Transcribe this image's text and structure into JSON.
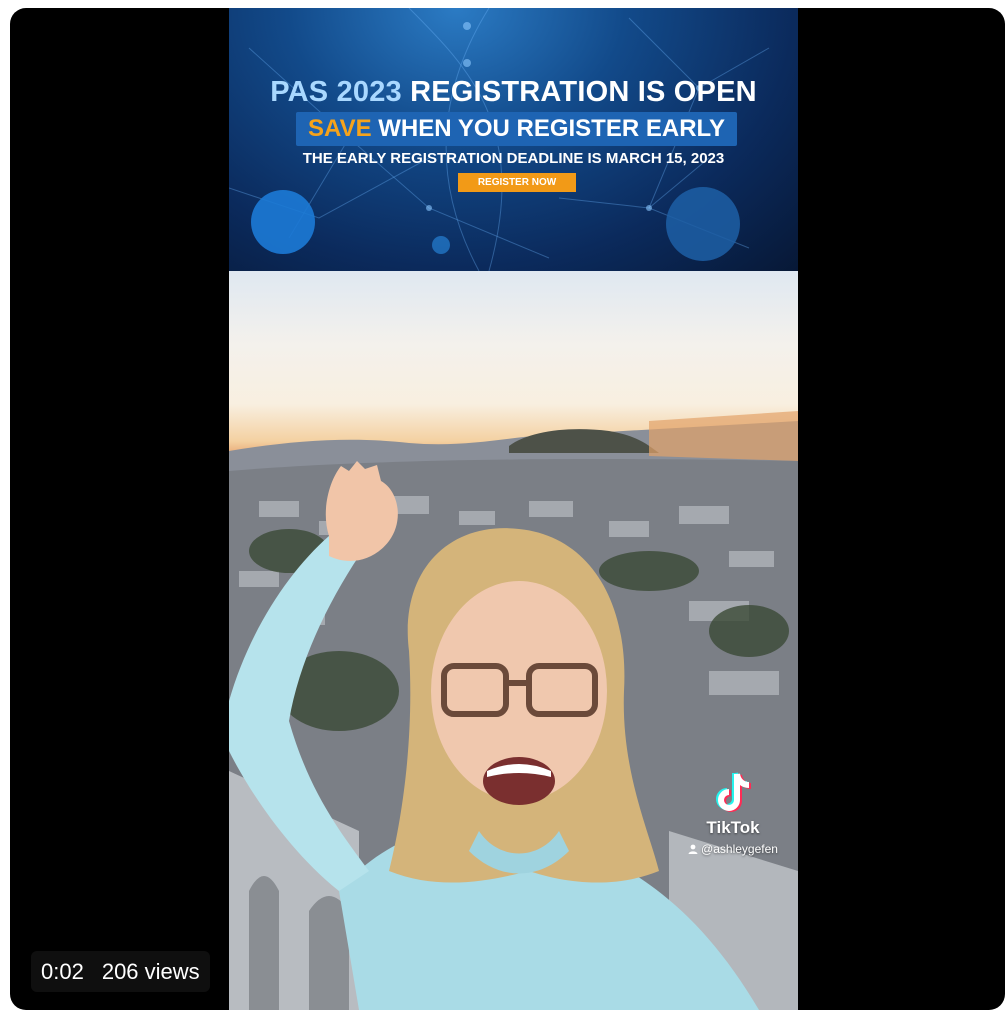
{
  "banner": {
    "title_highlight": "PAS 2023",
    "title_rest": " REGISTRATION IS OPEN",
    "save_highlight": "SAVE",
    "save_rest": " WHEN YOU REGISTER EARLY",
    "deadline": "THE EARLY REGISTRATION DEADLINE IS MARCH 15, 2023",
    "cta_label": "REGISTER NOW"
  },
  "watermark": {
    "app_name": "TikTok",
    "username": "@ashleygefen"
  },
  "overlay": {
    "time": "0:02",
    "views": "206 views"
  },
  "colors": {
    "player_bg": "#000000",
    "banner_blue": "#0b2a5c",
    "save_box": "#1e64b3",
    "accent_orange": "#f29a17",
    "tiktok_cyan": "#25f4ee",
    "tiktok_red": "#fe2c55"
  },
  "icons": {
    "watermark_logo": "tiktok-logo-icon",
    "user": "user-icon"
  }
}
